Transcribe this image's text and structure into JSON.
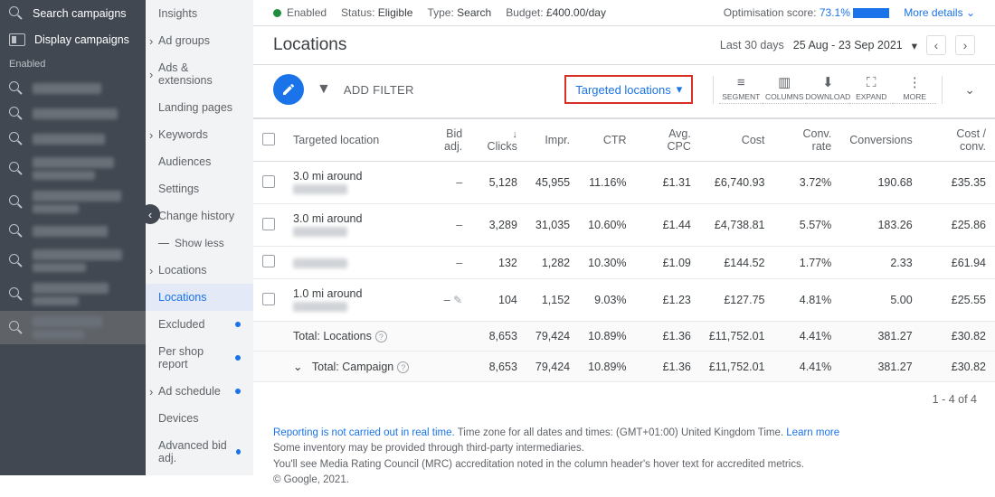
{
  "dark_sidebar": {
    "top": [
      {
        "icon": "search",
        "label": "Search campaigns"
      },
      {
        "icon": "display",
        "label": "Display campaigns"
      }
    ],
    "section": "Enabled",
    "blur_rows": 9
  },
  "light_sidebar": {
    "items_top": [
      "Insights",
      "Ad groups",
      "Ads & extensions",
      "Landing pages",
      "Keywords",
      "Audiences",
      "Settings",
      "Change history"
    ],
    "show_less": "Show less",
    "locations_group": [
      "Locations",
      "Locations",
      "Excluded",
      "Per shop report"
    ],
    "items_bottom": [
      "Ad schedule",
      "Devices",
      "Advanced bid adj."
    ]
  },
  "status": {
    "enabled": "Enabled",
    "status_label": "Status:",
    "status_val": "Eligible",
    "type_label": "Type:",
    "type_val": "Search",
    "budget_label": "Budget:",
    "budget_val": "£400.00/day",
    "opt_label": "Optimisation score:",
    "opt_val": "73.1%",
    "more": "More details"
  },
  "title": "Locations",
  "date": {
    "range_label": "Last 30 days",
    "range": "25 Aug - 23 Sep 2021"
  },
  "toolbar": {
    "add_filter": "ADD FILTER",
    "targeted": "Targeted locations",
    "tools": [
      "SEGMENT",
      "COLUMNS",
      "DOWNLOAD",
      "EXPAND",
      "MORE"
    ]
  },
  "table": {
    "headers": [
      "Targeted location",
      "Bid adj.",
      "Clicks",
      "Impr.",
      "CTR",
      "Avg. CPC",
      "Cost",
      "Conv. rate",
      "Conversions",
      "Cost / conv."
    ],
    "rows": [
      {
        "loc": "3.0 mi around",
        "bid": "–",
        "clicks": "5,128",
        "impr": "45,955",
        "ctr": "11.16%",
        "cpc": "£1.31",
        "cost": "£6,740.93",
        "crate": "3.72%",
        "conv": "190.68",
        "cconv": "£35.35"
      },
      {
        "loc": "3.0 mi around",
        "bid": "–",
        "clicks": "3,289",
        "impr": "31,035",
        "ctr": "10.60%",
        "cpc": "£1.44",
        "cost": "£4,738.81",
        "crate": "5.57%",
        "conv": "183.26",
        "cconv": "£25.86"
      },
      {
        "loc": "",
        "bid": "–",
        "clicks": "132",
        "impr": "1,282",
        "ctr": "10.30%",
        "cpc": "£1.09",
        "cost": "£144.52",
        "crate": "1.77%",
        "conv": "2.33",
        "cconv": "£61.94"
      },
      {
        "loc": "1.0 mi around",
        "bid": "–",
        "pencil": true,
        "clicks": "104",
        "impr": "1,152",
        "ctr": "9.03%",
        "cpc": "£1.23",
        "cost": "£127.75",
        "crate": "4.81%",
        "conv": "5.00",
        "cconv": "£25.55"
      }
    ],
    "totals": [
      {
        "label": "Total: Locations",
        "clicks": "8,653",
        "impr": "79,424",
        "ctr": "10.89%",
        "cpc": "£1.36",
        "cost": "£11,752.01",
        "crate": "4.41%",
        "conv": "381.27",
        "cconv": "£30.82"
      },
      {
        "label": "Total: Campaign",
        "chev": true,
        "clicks": "8,653",
        "impr": "79,424",
        "ctr": "10.89%",
        "cpc": "£1.36",
        "cost": "£11,752.01",
        "crate": "4.41%",
        "conv": "381.27",
        "cconv": "£30.82"
      }
    ],
    "pagination": "1 - 4 of 4"
  },
  "footer": {
    "l1a": "Reporting is not carried out in real time.",
    "l1b": " Time zone for all dates and times: (GMT+01:00) United Kingdom Time. ",
    "l1c": "Learn more",
    "l2": "Some inventory may be provided through third-party intermediaries.",
    "l3": "You'll see Media Rating Council (MRC) accreditation noted in the column header's hover text for accredited metrics.",
    "l4": "© Google, 2021."
  }
}
